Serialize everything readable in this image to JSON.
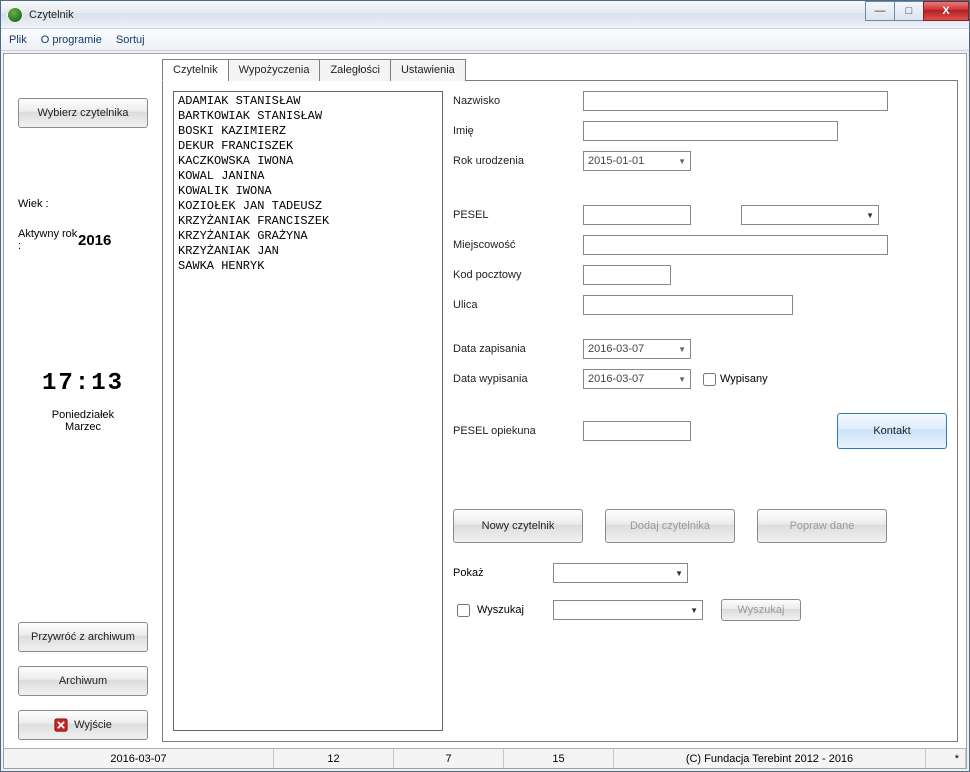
{
  "title": "Czytelnik",
  "menu": {
    "plik": "Plik",
    "oprog": "O programie",
    "sortuj": "Sortuj"
  },
  "winbtns": {
    "min": "—",
    "max": "□",
    "close": "X"
  },
  "sidebar": {
    "select_reader": "Wybierz czytelnika",
    "wiek_label": "Wiek :",
    "wiek_value": "",
    "year_label": "Aktywny rok :",
    "year_value": "2016",
    "time": "17:13",
    "day": "Poniedziałek",
    "month": "Marzec",
    "restore": "Przywróć z archiwum",
    "archive": "Archiwum",
    "exit": "Wyjście"
  },
  "tabs": {
    "t0": "Czytelnik",
    "t1": "Wypożyczenia",
    "t2": "Zaległości",
    "t3": "Ustawienia"
  },
  "readers": [
    "ADAMIAK STANISŁAW",
    "BARTKOWIAK STANISŁAW",
    "BOSKI KAZIMIERZ",
    "DEKUR FRANCISZEK",
    "KACZKOWSKA IWONA",
    "KOWAL JANINA",
    "KOWALIK IWONA",
    "KOZIOŁEK JAN TADEUSZ",
    "KRZYŻANIAK FRANCISZEK",
    "KRZYŻANIAK GRAŻYNA",
    "KRZYŻANIAK JAN",
    "SAWKA HENRYK"
  ],
  "form": {
    "nazwisko": "Nazwisko",
    "imie": "Imię",
    "rok_ur": "Rok urodzenia",
    "rok_ur_val": "2015-01-01",
    "pesel": "PESEL",
    "miejscowosc": "Miejscowość",
    "kod": "Kod pocztowy",
    "ulica": "Ulica",
    "data_zap": "Data zapisania",
    "data_zap_val": "2016-03-07",
    "data_wyp": "Data wypisania",
    "data_wyp_val": "2016-03-07",
    "wypisany": "Wypisany",
    "pesel_op": "PESEL opiekuna",
    "kontakt": "Kontakt",
    "nowy": "Nowy czytelnik",
    "dodaj": "Dodaj czytelnika",
    "popraw": "Popraw dane",
    "pokaz": "Pokaż",
    "wyszukaj_lbl": "Wyszukaj",
    "wyszukaj_btn": "Wyszukaj"
  },
  "status": {
    "date": "2016-03-07",
    "n1": "12",
    "n2": "7",
    "n3": "15",
    "copyright": "(C) Fundacja Terebint 2012 - 2016",
    "mark": "*"
  }
}
